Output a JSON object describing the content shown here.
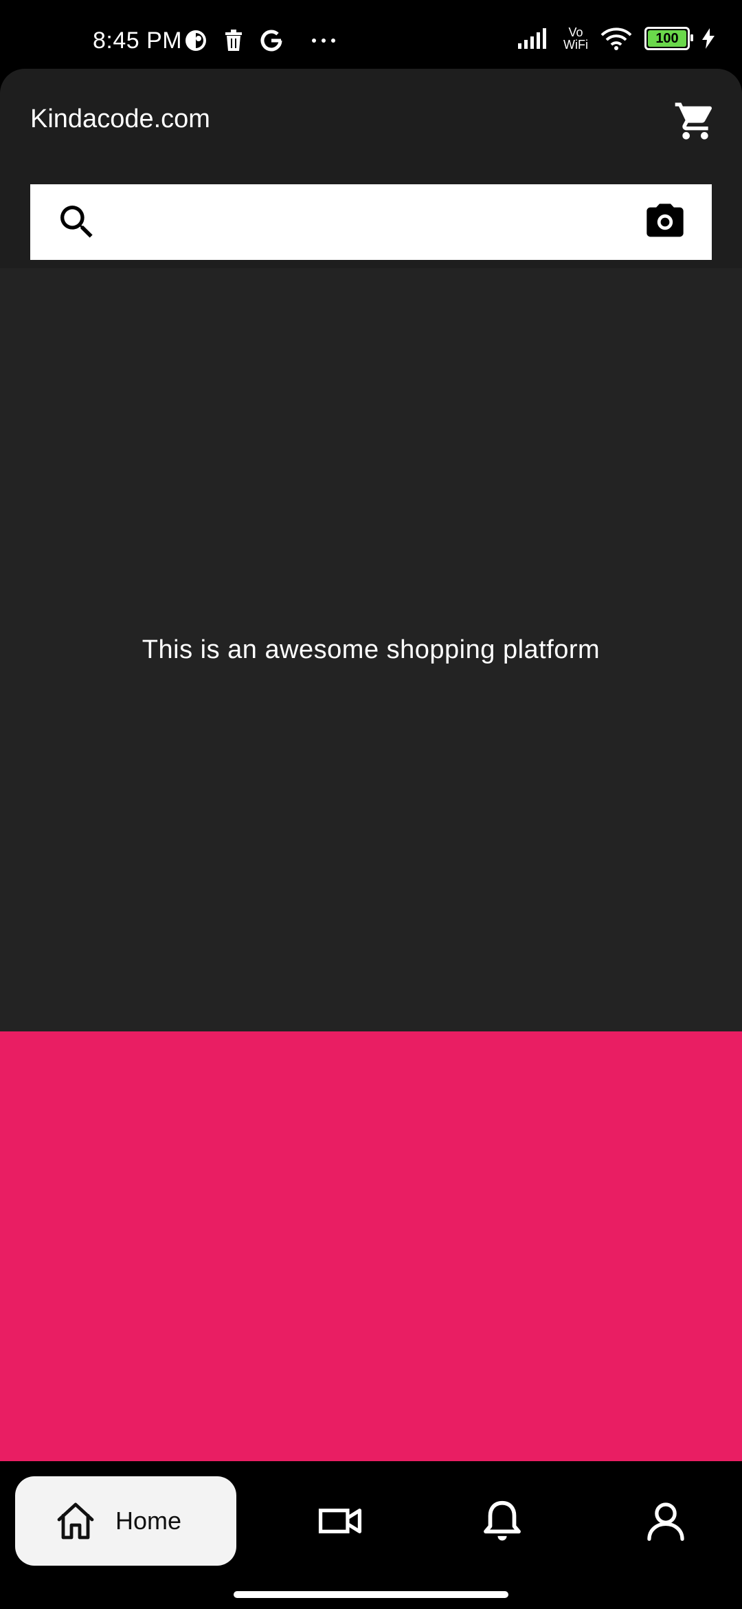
{
  "status_bar": {
    "time": "8:45 PM",
    "vo": "Vo",
    "wifi_label": "WiFi",
    "battery": "100",
    "icons": [
      "app-icon",
      "trash-icon",
      "google-icon",
      "more-dots-icon",
      "signal-icon",
      "wifi-icon",
      "battery-icon",
      "charging-icon"
    ]
  },
  "appbar": {
    "title": "Kindacode.com",
    "cart_icon": "cart-icon"
  },
  "search": {
    "placeholder": "",
    "value": "",
    "left_icon": "search-icon",
    "right_icon": "camera-icon"
  },
  "main": {
    "message": "This is an awesome shopping platform"
  },
  "colors": {
    "appbar_bg": "#1e1e1e",
    "main_bg": "#232323",
    "accent_pink": "#e91e63",
    "nav_active_bg": "#f3f3f3"
  },
  "bottom_nav": {
    "items": [
      {
        "label": "Home",
        "icon": "home-icon",
        "active": true
      },
      {
        "label": "",
        "icon": "video-icon",
        "active": false
      },
      {
        "label": "",
        "icon": "bell-icon",
        "active": false
      },
      {
        "label": "",
        "icon": "profile-icon",
        "active": false
      }
    ]
  }
}
